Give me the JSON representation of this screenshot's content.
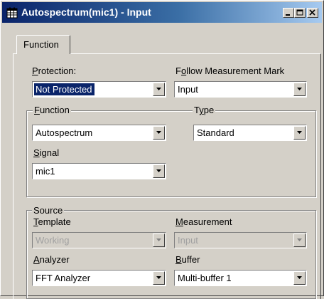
{
  "window": {
    "title": "Autospectrum(mic1) - Input",
    "icon": "app-grid-icon",
    "controls": {
      "minimize": "minimize-icon",
      "maximize": "maximize-icon",
      "close": "close-icon"
    }
  },
  "tabs": [
    {
      "label": "Function",
      "active": true
    }
  ],
  "protection": {
    "label_pre": "",
    "label_key": "P",
    "label_post": "rotection:",
    "value": "Not Protected"
  },
  "follow": {
    "label_pre": "F",
    "label_key": "o",
    "label_post": "llow Measurement Mark",
    "value": "Input"
  },
  "function_group": {
    "legend_pre": "",
    "legend_key": "F",
    "legend_post": "unction",
    "value": "Autospectrum",
    "signal_label_pre": "",
    "signal_label_key": "S",
    "signal_label_post": "ignal",
    "signal_value": "mic1"
  },
  "type_group": {
    "legend_pre": "T",
    "legend_key": "y",
    "legend_post": "pe",
    "value": "Standard"
  },
  "source_group": {
    "legend": "Source",
    "template_label_pre": "",
    "template_label_key": "T",
    "template_label_post": "emplate",
    "template_value": "Working",
    "measurement_label_pre": "",
    "measurement_label_key": "M",
    "measurement_label_post": "easurement",
    "measurement_value": "Input",
    "analyzer_label_pre": "",
    "analyzer_label_key": "A",
    "analyzer_label_post": "nalyzer",
    "analyzer_value": "FFT Analyzer",
    "buffer_label_pre": "",
    "buffer_label_key": "B",
    "buffer_label_post": "uffer",
    "buffer_value": "Multi-buffer 1"
  },
  "colors": {
    "titlebar_start": "#0a246a",
    "titlebar_end": "#a6caf0",
    "face": "#d4d0c8",
    "selection": "#0a246a"
  }
}
